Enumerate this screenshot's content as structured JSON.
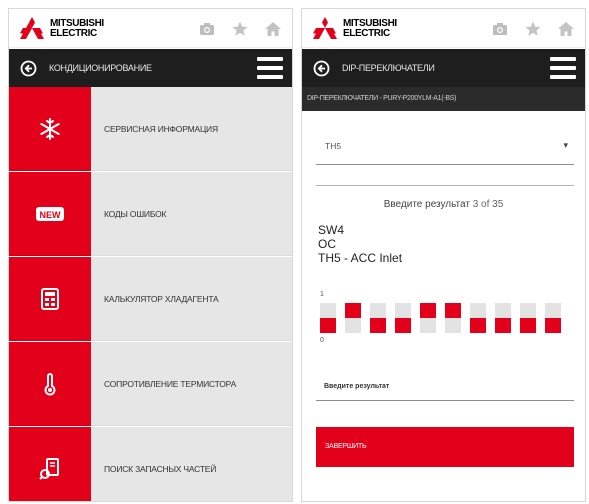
{
  "brand": {
    "logo_lines": [
      "MITSUBISHI",
      "ELECTRIC"
    ],
    "accent_color": "#e2001a",
    "dark_color": "#1e1e1e"
  },
  "header_icons": [
    "camera-icon",
    "star-icon",
    "home-icon"
  ],
  "left_screen": {
    "nav_title": "КОНДИЦИОНИРОВАНИЕ",
    "menu_items": [
      {
        "icon": "snowflake-icon",
        "label": "СЕРВИСНАЯ ИНФОРМАЦИЯ"
      },
      {
        "icon": "new-badge-icon",
        "icon_text": "NEW",
        "label": "КОДЫ ОШИБОК"
      },
      {
        "icon": "calculator-icon",
        "label": "КАЛЬКУЛЯТОР ХЛАДАГЕНТА"
      },
      {
        "icon": "thermometer-icon",
        "label": "СОПРОТИВЛЕНИЕ ТЕРМИСТОРА"
      },
      {
        "icon": "parts-search-icon",
        "label": "ПОИСК ЗАПАСНЫХ ЧАСТЕЙ"
      }
    ]
  },
  "right_screen": {
    "nav_title": "DIP-ПЕРЕКЛЮЧАТЕЛИ",
    "breadcrumb": "DIP-ПЕРЕКЛЮЧАТЕЛИ - PURY-P200YLM-A1(-BS)",
    "select_value": "TH5",
    "counter_prefix": "Введите результат",
    "counter_value": "3 of 35",
    "switch_lines": [
      "SW4",
      "OC",
      "TH5 - ACC Inlet"
    ],
    "dip_label_on": "1",
    "dip_label_off": "0",
    "dip_states": [
      0,
      1,
      0,
      0,
      1,
      1,
      0,
      0,
      0,
      0
    ],
    "input_placeholder": "Введите результат",
    "finish_label": "ЗАВЕРШИТЬ"
  }
}
